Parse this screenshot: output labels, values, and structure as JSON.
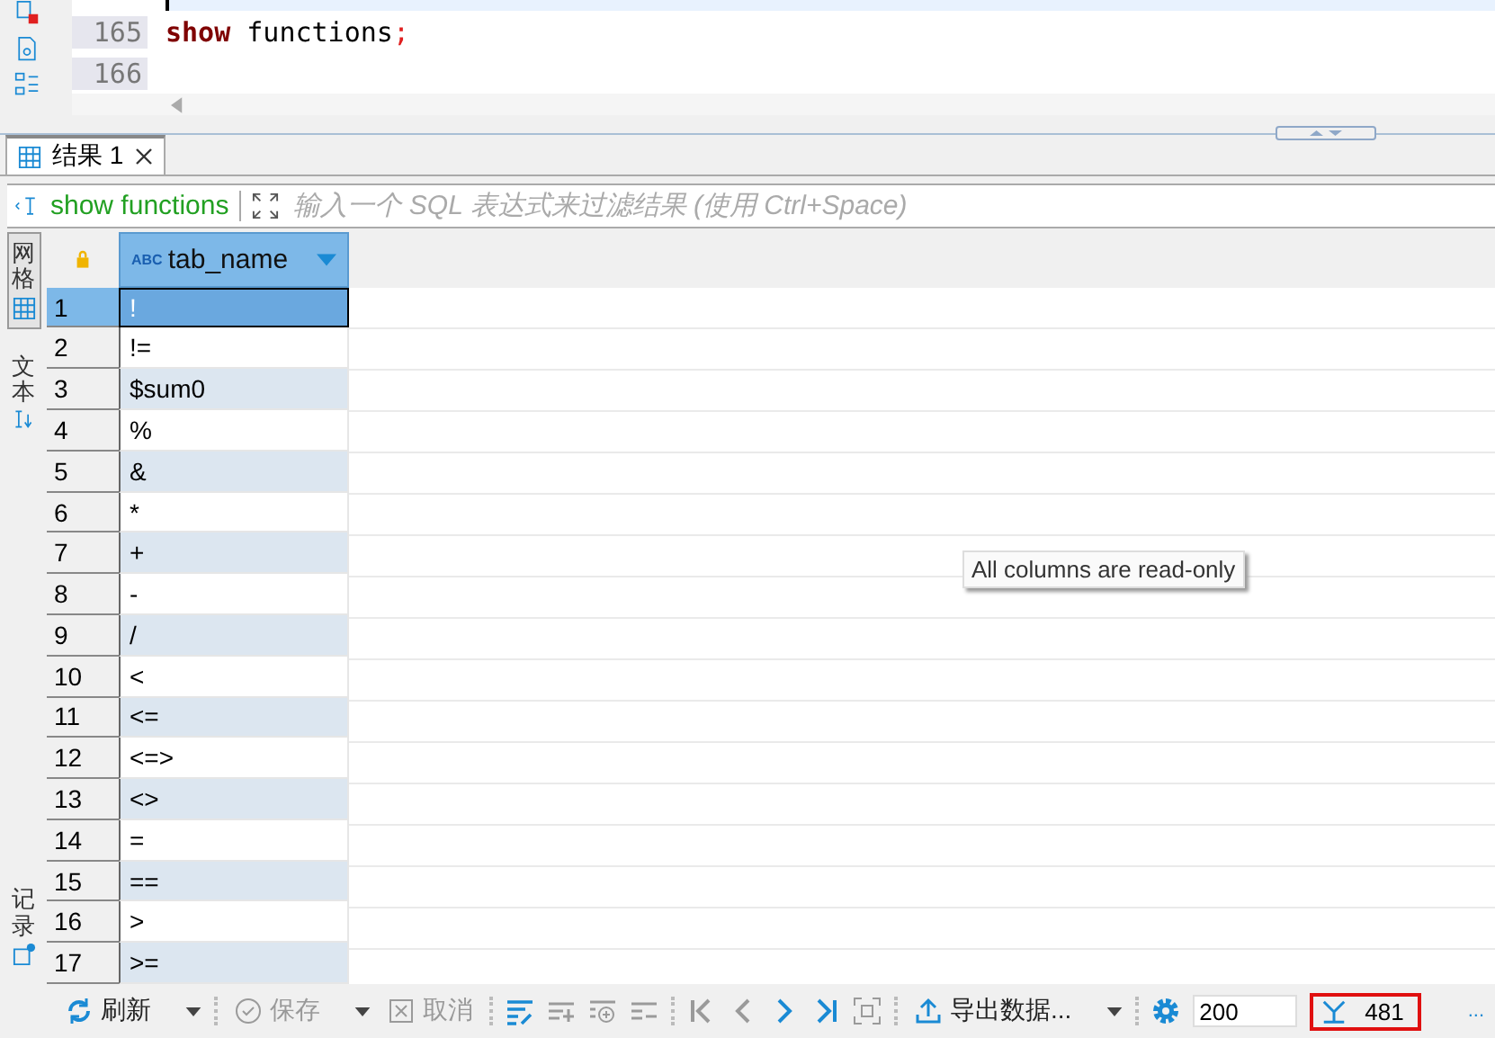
{
  "editor": {
    "lines": [
      {
        "number": "165",
        "tokens": [
          {
            "text": "show",
            "kind": "keyword"
          },
          {
            "text": " functions",
            "kind": "plain"
          },
          {
            "text": ";",
            "kind": "punct"
          }
        ]
      },
      {
        "number": "166"
      }
    ]
  },
  "result_tab": {
    "label": "结果 1",
    "selected": true
  },
  "filter": {
    "query": "show functions",
    "placeholder": "输入一个 SQL 表达式来过滤结果 (使用 Ctrl+Space)"
  },
  "side_tabs_top": [
    {
      "label": "网格",
      "selected": true
    },
    {
      "label": "文本",
      "selected": false
    }
  ],
  "side_tabs_bottom": [
    {
      "label": "记录",
      "selected": false
    }
  ],
  "table": {
    "columns": [
      {
        "type": "ABC",
        "label": "tab_name"
      }
    ],
    "rows": [
      {
        "number": "1",
        "value": "!",
        "selected": true
      },
      {
        "number": "2",
        "value": "!=",
        "selected": false
      },
      {
        "number": "3",
        "value": "$sum0",
        "selected": false
      },
      {
        "number": "4",
        "value": "%",
        "selected": false
      },
      {
        "number": "5",
        "value": "&",
        "selected": false
      },
      {
        "number": "6",
        "value": "*",
        "selected": false
      },
      {
        "number": "7",
        "value": "+",
        "selected": false
      },
      {
        "number": "8",
        "value": "-",
        "selected": false
      },
      {
        "number": "9",
        "value": "/",
        "selected": false
      },
      {
        "number": "10",
        "value": "<",
        "selected": false
      },
      {
        "number": "11",
        "value": "<=",
        "selected": false
      },
      {
        "number": "12",
        "value": "<=>",
        "selected": false
      },
      {
        "number": "13",
        "value": "<>",
        "selected": false
      },
      {
        "number": "14",
        "value": "=",
        "selected": false
      },
      {
        "number": "15",
        "value": "==",
        "selected": false
      },
      {
        "number": "16",
        "value": ">",
        "selected": false
      },
      {
        "number": "17",
        "value": ">=",
        "selected": false
      }
    ]
  },
  "tooltip": "All columns are read-only",
  "toolbar": [
    {
      "kind": "refresh",
      "label": "刷新",
      "disabled": false
    },
    {
      "kind": "caret"
    },
    {
      "kind": "separator"
    },
    {
      "kind": "save",
      "label": "保存",
      "disabled": true
    },
    {
      "kind": "caret"
    },
    {
      "kind": "cancel",
      "label": "取消",
      "disabled": true
    },
    {
      "kind": "separator"
    },
    {
      "kind": "edit-lines",
      "disabled": false
    },
    {
      "kind": "add-row",
      "disabled": true
    },
    {
      "kind": "copy-row",
      "disabled": true
    },
    {
      "kind": "delete-row",
      "disabled": true
    },
    {
      "kind": "separator"
    },
    {
      "kind": "first",
      "disabled": true
    },
    {
      "kind": "prev",
      "disabled": true
    },
    {
      "kind": "next",
      "disabled": false
    },
    {
      "kind": "last",
      "disabled": false
    },
    {
      "kind": "frame",
      "disabled": true
    },
    {
      "kind": "separator"
    },
    {
      "kind": "export",
      "label": "导出数据...",
      "disabled": false
    },
    {
      "kind": "caret"
    },
    {
      "kind": "separator"
    },
    {
      "kind": "gear",
      "disabled": false
    }
  ],
  "fetch_size": "200",
  "row_count": "481",
  "more": "..."
}
